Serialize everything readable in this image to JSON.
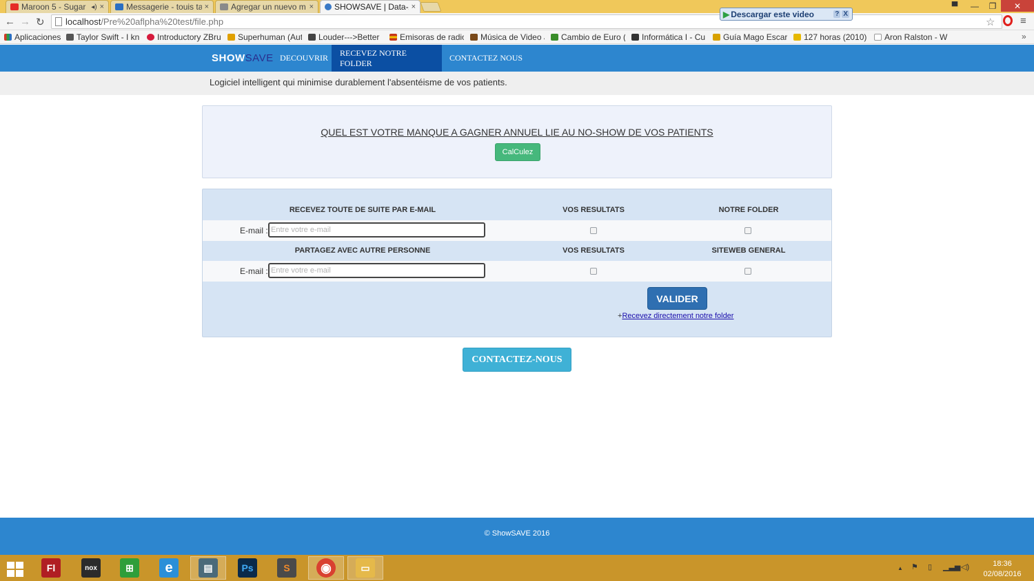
{
  "browser": {
    "tabs": [
      {
        "label": "Maroon 5 - Sugar",
        "extra": "◂)"
      },
      {
        "label": "Messagerie - touis ta"
      },
      {
        "label": "Agregar un nuevo m"
      },
      {
        "label": "SHOWSAVE | Data-A"
      }
    ],
    "tab_close": "×",
    "window_controls": {
      "minimize": "—",
      "restore": "❐",
      "close": "✕"
    },
    "download_video": {
      "label": "Descargar este video",
      "help": "?",
      "close": "X"
    },
    "url": {
      "host": "localhost",
      "path": "/Pre%20aflpha%20test/file.php"
    },
    "bookmarks": [
      {
        "label": "Aplicaciones",
        "color": "#d23c2a"
      },
      {
        "label": "Taylor Swift - I kn",
        "color": "#555555"
      },
      {
        "label": "Introductory ZBru",
        "color": "#d61a3c"
      },
      {
        "label": "Superhuman (Aut",
        "color": "#e0a000"
      },
      {
        "label": "Louder--->Better",
        "color": "#444444"
      },
      {
        "label": "Emisoras de radio",
        "color": "#c7361a"
      },
      {
        "label": "Música de Video J",
        "color": "#7a4a1a"
      },
      {
        "label": "Cambio de Euro (",
        "color": "#3a8d2a"
      },
      {
        "label": "Informática I - Cu",
        "color": "#333333"
      },
      {
        "label": "Guía Mago Escarc",
        "color": "#d8a100"
      },
      {
        "label": "127 horas (2010)",
        "color": "#e6b800"
      },
      {
        "label": "Aron Ralston - W",
        "color": "#222222"
      }
    ],
    "bookmarks_more": "»"
  },
  "site": {
    "logo": {
      "part1": "SHOW",
      "part2": "SAVE"
    },
    "nav": [
      "DECOUVRIR",
      "RECEVEZ NOTRE FOLDER",
      "CONTACTEZ NOUS"
    ],
    "tagline": "Logiciel intelligent qui minimise durablement l'absentéisme de vos patients.",
    "calc": {
      "title": "QUEL EST VOTRE MANQUE A GAGNER ANNUEL LIE AU NO-SHOW DE VOS PATIENTS",
      "button": "CalCulez"
    },
    "form": {
      "section1": {
        "header": "RECEVEZ  TOUTE DE SUITE PAR E-MAIL",
        "col2": "VOS RESULTATS",
        "col3": "NOTRE FOLDER"
      },
      "section2": {
        "header": "PARTAGEZ AVEC AUTRE PERSONNE",
        "col2": "VOS RESULTATS",
        "col3": "SITEWEB GENERAL"
      },
      "email_label": "E-mail :",
      "email_placeholder": "Entre votre e-mail",
      "submit": "VALIDER",
      "folder_prefix": "+",
      "folder_link": "Recevez directement notre folder"
    },
    "contact_button": "CONTACTEZ-NOUS",
    "footer": "© ShowSAVE 2016"
  },
  "taskbar": {
    "apps": [
      {
        "name": "flash",
        "label": "Fl",
        "color": "#b01e23"
      },
      {
        "name": "nox",
        "label": "nox",
        "color": "#2b2b2b"
      },
      {
        "name": "store",
        "label": "⊞",
        "color": "#2f9e3a"
      },
      {
        "name": "ie",
        "label": "e",
        "color": "#2a8fd8"
      },
      {
        "name": "explorer-window",
        "label": "▤",
        "color": "#4b6a7a"
      },
      {
        "name": "photoshop",
        "label": "Ps",
        "color": "#0a2a4a"
      },
      {
        "name": "sublime",
        "label": "S",
        "color": "#4a4a4a"
      },
      {
        "name": "chrome",
        "label": "◉",
        "color": "#d94030"
      },
      {
        "name": "file-explorer",
        "label": "▭",
        "color": "#e5b94a"
      }
    ],
    "tray_arrow": "▲",
    "time": "18:36",
    "date": "02/08/2016"
  }
}
